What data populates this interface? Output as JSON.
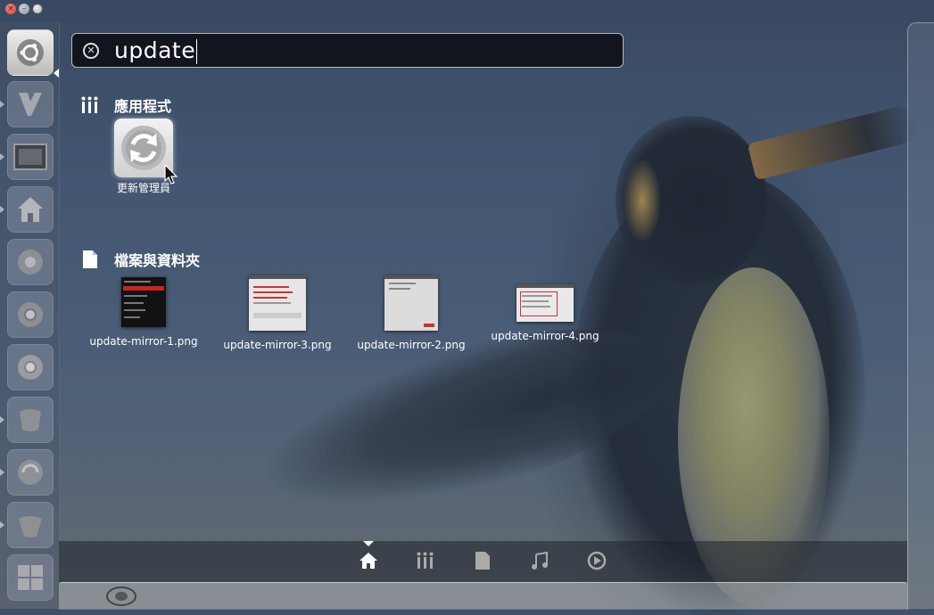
{
  "search": {
    "query": "update"
  },
  "sections": {
    "applications": {
      "title": "應用程式"
    },
    "files": {
      "title": "檔案與資料夾"
    }
  },
  "app_results": [
    {
      "label": "更新管理員",
      "icon": "refresh-icon"
    }
  ],
  "file_results": [
    {
      "name": "update-mirror-1.png"
    },
    {
      "name": "update-mirror-3.png"
    },
    {
      "name": "update-mirror-2.png"
    },
    {
      "name": "update-mirror-4.png"
    }
  ],
  "lenses": [
    {
      "icon": "home-icon",
      "active": true
    },
    {
      "icon": "applications-icon"
    },
    {
      "icon": "files-icon"
    },
    {
      "icon": "music-icon"
    },
    {
      "icon": "video-icon"
    }
  ],
  "launcher": [
    {
      "icon": "ubuntu-logo-icon"
    },
    {
      "icon": "vim-icon"
    },
    {
      "icon": "screenshot-icon"
    },
    {
      "icon": "home-folder-icon"
    },
    {
      "icon": "app-icon"
    },
    {
      "icon": "chromium-icon"
    },
    {
      "icon": "chrome-icon"
    },
    {
      "icon": "app-icon"
    },
    {
      "icon": "app-icon"
    },
    {
      "icon": "app-icon"
    },
    {
      "icon": "workspace-switcher-icon"
    }
  ]
}
